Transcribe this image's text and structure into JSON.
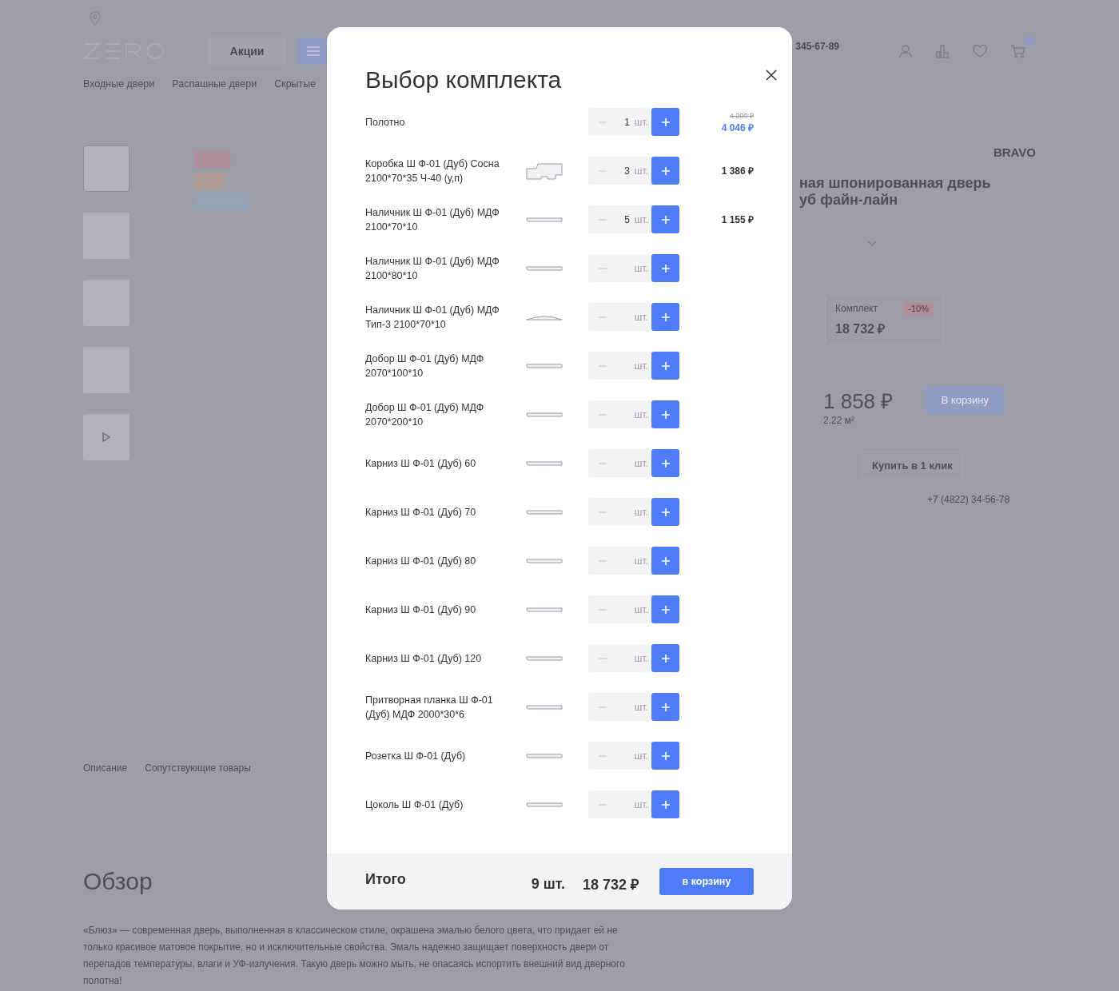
{
  "background_page": {
    "header": {
      "promo_button": "Акции",
      "phone": "345-67-89"
    },
    "nav": [
      "Входные двери",
      "Распашные двери",
      "Скрытые"
    ],
    "product": {
      "brand": "BRAVO",
      "title_lines": [
        "ная шпонированная дверь",
        "уб файн-лайн"
      ],
      "set_option": {
        "label": "Комплект",
        "discount": "-10%",
        "price": "18 732 ₽"
      },
      "price": "1 858 ₽",
      "area": "2.22 м²",
      "cart_button": "В корзину",
      "one_click_button": "Купить в 1 клик",
      "phone": "+7 (4822) 34-56-78"
    },
    "tabs": [
      "Описание",
      "Сопутствующие товары"
    ],
    "overview": {
      "title": "Обзор",
      "text": "«Блюз» — современная дверь, выполненная в классическом стиле, окрашена эмалью белого цвета, что придает ей не только красивое матовое покрытие, но и исключительные свойства. Эмаль надежно защищает поверхность двери от перепадов температуры, влаги и УФ-излучения. Такую дверь можно мыть, не опасаясь испортить внешний вид дверного полотна!"
    }
  },
  "modal": {
    "title": "Выбор комплекта",
    "items": [
      {
        "name": "Полотно",
        "kind": "plain",
        "qty": "1",
        "unit": "шт.",
        "old_price": "4 200 ₽",
        "price": "4 046 ₽"
      },
      {
        "name": "Коробка Ш Ф-01 (Дуб) Сосна 2100*70*35 Ч-40 (у,п)",
        "kind": "frame",
        "qty": "3",
        "unit": "шт.",
        "price": "1 386 ₽"
      },
      {
        "name": "Наличник Ш Ф-01 (Дуб) МДФ 2100*70*10",
        "kind": "flat",
        "qty": "5",
        "unit": "шт.",
        "price": "1 155 ₽"
      },
      {
        "name": "Наличник Ш Ф-01 (Дуб) МДФ 2100*80*10",
        "kind": "flat",
        "unit": "шт."
      },
      {
        "name": "Наличник Ш Ф-01 (Дуб) МДФ Тип-3 2100*70*10",
        "kind": "arched",
        "unit": "шт."
      },
      {
        "name": "Добор Ш Ф-01 (Дуб) МДФ 2070*100*10",
        "kind": "flat",
        "unit": "шт."
      },
      {
        "name": "Добор Ш Ф-01 (Дуб) МДФ 2070*200*10",
        "kind": "flat",
        "unit": "шт."
      },
      {
        "name": "Карниз Ш Ф-01 (Дуб) 60",
        "kind": "flat",
        "unit": "шт."
      },
      {
        "name": "Карниз Ш Ф-01 (Дуб) 70",
        "kind": "flat",
        "unit": "шт."
      },
      {
        "name": "Карниз Ш Ф-01 (Дуб) 80",
        "kind": "flat",
        "unit": "шт."
      },
      {
        "name": "Карниз Ш Ф-01 (Дуб) 90",
        "kind": "flat",
        "unit": "шт."
      },
      {
        "name": "Карниз Ш Ф-01 (Дуб) 120",
        "kind": "flat",
        "unit": "шт."
      },
      {
        "name": "Притворная планка Ш Ф-01 (Дуб) МДФ 2000*30*6",
        "kind": "flat",
        "unit": "шт."
      },
      {
        "name": "Розетка Ш Ф-01 (Дуб)",
        "kind": "flat",
        "unit": "шт."
      },
      {
        "name": "Цоколь Ш Ф-01 (Дуб)",
        "kind": "flat",
        "unit": "шт."
      }
    ],
    "total": {
      "label": "Итого",
      "count": "9 шт.",
      "sum": "18 732 ₽",
      "button": "в корзину"
    }
  }
}
